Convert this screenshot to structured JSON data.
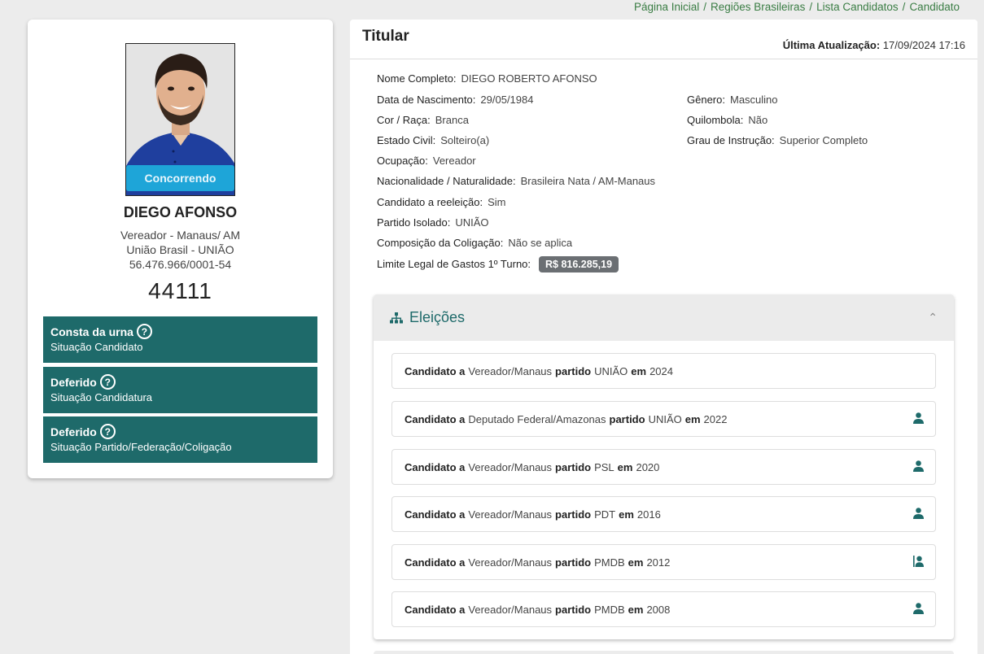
{
  "breadcrumb": [
    "Página Inicial",
    "Regiões Brasileiras",
    "Lista Candidatos",
    "Candidato"
  ],
  "candidate": {
    "status_pill": "Concorrendo",
    "name": "DIEGO AFONSO",
    "role_line": "Vereador - Manaus/ AM",
    "party_line": "União Brasil - UNIÃO",
    "cnpj": "56.476.966/0001-54",
    "number": "44111"
  },
  "situations": [
    {
      "title": "Consta da urna",
      "subtitle": "Situação Candidato"
    },
    {
      "title": "Deferido",
      "subtitle": "Situação Candidatura"
    },
    {
      "title": "Deferido",
      "subtitle": "Situação Partido/Federação/Coligação"
    }
  ],
  "titular": {
    "heading": "Titular",
    "updated_label": "Última Atualização:",
    "updated_value": "17/09/2024 17:16"
  },
  "fields": {
    "nome": {
      "label": "Nome Completo:",
      "value": "DIEGO ROBERTO AFONSO"
    },
    "nascimento": {
      "label": "Data de Nascimento:",
      "value": "29/05/1984"
    },
    "genero": {
      "label": "Gênero:",
      "value": "Masculino"
    },
    "cor": {
      "label": "Cor / Raça:",
      "value": "Branca"
    },
    "quilombola": {
      "label": "Quilombola:",
      "value": "Não"
    },
    "estado_civil": {
      "label": "Estado Civil:",
      "value": "Solteiro(a)"
    },
    "instrucao": {
      "label": "Grau de Instrução:",
      "value": "Superior Completo"
    },
    "ocupacao": {
      "label": "Ocupação:",
      "value": "Vereador"
    },
    "nacionalidade": {
      "label": "Nacionalidade / Naturalidade:",
      "value": "Brasileira Nata / AM-Manaus"
    },
    "reeleicao": {
      "label": "Candidato a reeleição:",
      "value": "Sim"
    },
    "partido": {
      "label": "Partido Isolado:",
      "value": "UNIÃO"
    },
    "coligacao": {
      "label": "Composição da Coligação:",
      "value": "Não se aplica"
    },
    "limite": {
      "label": "Limite Legal de Gastos 1º Turno:",
      "value": "R$ 816.285,19"
    }
  },
  "elections": {
    "title": "Eleições",
    "word_candidato": "Candidato a",
    "word_partido": "partido",
    "word_em": "em",
    "rows": [
      {
        "cargo": "Vereador/Manaus",
        "partido": "UNIÃO",
        "ano": "2024",
        "icon": ""
      },
      {
        "cargo": "Deputado Federal/Amazonas",
        "partido": "UNIÃO",
        "ano": "2022",
        "icon": "person-icon"
      },
      {
        "cargo": "Vereador/Manaus",
        "partido": "PSL",
        "ano": "2020",
        "icon": "person-icon"
      },
      {
        "cargo": "Vereador/Manaus",
        "partido": "PDT",
        "ano": "2016",
        "icon": "person-icon"
      },
      {
        "cargo": "Vereador/Manaus",
        "partido": "PMDB",
        "ano": "2012",
        "icon": "person-badge-icon"
      },
      {
        "cargo": "Vereador/Manaus",
        "partido": "PMDB",
        "ano": "2008",
        "icon": "person-icon"
      }
    ]
  },
  "colors": {
    "teal": "#1e6a6a",
    "breadcrumb_green": "#3a7d44",
    "status_blue": "#1ea5d8"
  }
}
